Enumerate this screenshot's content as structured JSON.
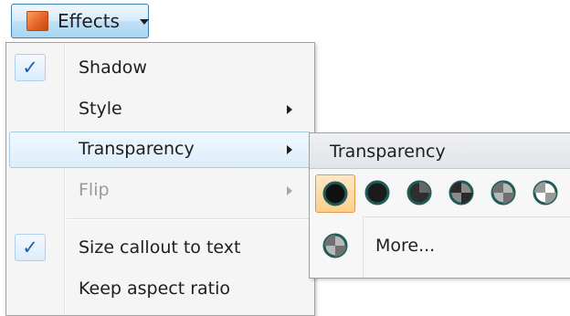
{
  "toolbar": {
    "effects_label": "Effects",
    "effects_icon": "effects-shape-icon",
    "dropdown_icon": "chevron-down-icon"
  },
  "menu": {
    "items": [
      {
        "label": "Shadow",
        "checked": true,
        "submenu": false,
        "disabled": false
      },
      {
        "label": "Style",
        "checked": false,
        "submenu": true,
        "disabled": false
      },
      {
        "label": "Transparency",
        "checked": false,
        "submenu": true,
        "disabled": false,
        "highlighted": true
      },
      {
        "label": "Flip",
        "checked": false,
        "submenu": true,
        "disabled": true
      },
      {
        "label": "Size callout to text",
        "checked": true,
        "submenu": false,
        "disabled": false
      },
      {
        "label": "Keep aspect ratio",
        "checked": false,
        "submenu": false,
        "disabled": false
      }
    ],
    "check_glyph": "✓"
  },
  "transparency": {
    "title": "Transparency",
    "swatches": [
      {
        "name": "opaque",
        "fill_fraction": 1.0,
        "selected": true
      },
      {
        "name": "level-1",
        "fill_fraction": 0.92,
        "selected": false
      },
      {
        "name": "level-2",
        "fill_fraction": 0.75,
        "selected": false
      },
      {
        "name": "level-3",
        "fill_fraction": 0.5,
        "selected": false
      },
      {
        "name": "level-4",
        "fill_fraction": 0.25,
        "selected": false
      },
      {
        "name": "level-5",
        "fill_fraction": 0.1,
        "selected": false
      }
    ],
    "more_label": "More..."
  },
  "colors": {
    "swatch_ring": "#1f5c57",
    "swatch_fill": "#111111",
    "highlight_border": "#a5cde9",
    "selected_border": "#e19a4a",
    "check_color": "#1c5fb4"
  }
}
